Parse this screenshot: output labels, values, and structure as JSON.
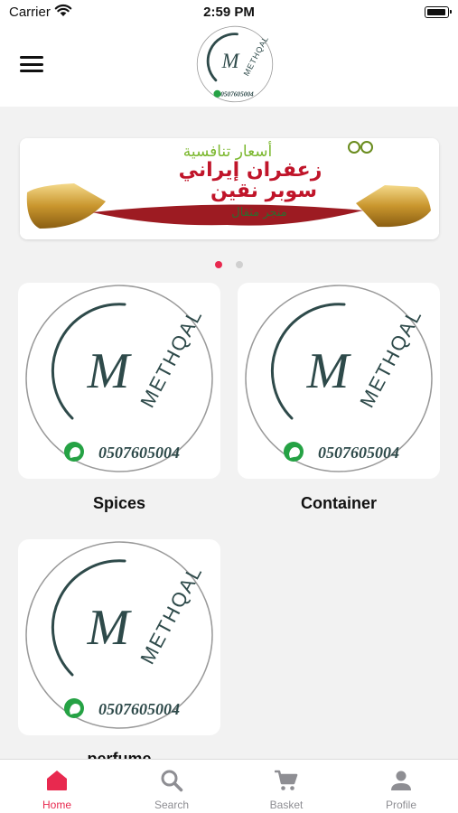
{
  "status_bar": {
    "carrier": "Carrier",
    "time": "2:59 PM"
  },
  "brand": {
    "logo_letter": "M",
    "logo_word": "METHQAL",
    "phone": "0507605004",
    "logo_color": "#2e4a4a",
    "whatsapp_color": "#25a244"
  },
  "banner": {
    "line1": "أسعار تنافسية",
    "line2": "زعفران إيراني",
    "line3": "سوبر نقين",
    "line4": "متجر مثقال",
    "colors": {
      "green": "#7cb82f",
      "red": "#c0152a",
      "dark_green": "#2e6b2e"
    },
    "slide_count": 2,
    "active_slide": 1
  },
  "categories": [
    {
      "label": "Spices"
    },
    {
      "label": "Container"
    },
    {
      "label": "perfume"
    }
  ],
  "tabbar": {
    "active_color": "#e8294f",
    "inactive_color": "#8e8e93",
    "items": [
      {
        "label": "Home",
        "icon": "home-icon",
        "active": true
      },
      {
        "label": "Search",
        "icon": "search-icon",
        "active": false
      },
      {
        "label": "Basket",
        "icon": "cart-icon",
        "active": false
      },
      {
        "label": "Profile",
        "icon": "person-icon",
        "active": false
      }
    ]
  }
}
